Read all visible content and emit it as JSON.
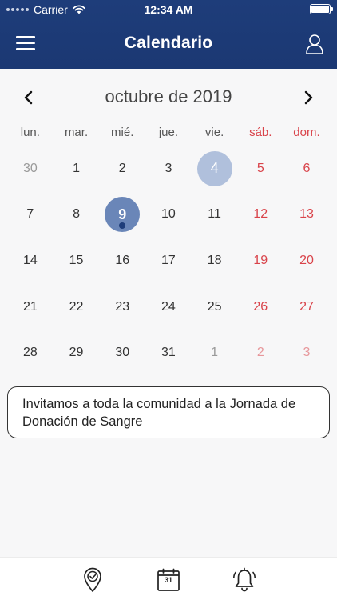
{
  "status_bar": {
    "carrier": "Carrier",
    "time": "12:34 AM"
  },
  "header": {
    "title": "Calendario",
    "menu_icon": "hamburger-menu-icon",
    "user_icon": "user-icon"
  },
  "calendar": {
    "month_label": "octubre de 2019",
    "weekdays": [
      "lun.",
      "mar.",
      "mié.",
      "jue.",
      "vie.",
      "sáb.",
      "dom."
    ],
    "weeks": [
      [
        {
          "d": "30",
          "muted": true
        },
        {
          "d": "1"
        },
        {
          "d": "2"
        },
        {
          "d": "3"
        },
        {
          "d": "4",
          "today": true
        },
        {
          "d": "5"
        },
        {
          "d": "6"
        }
      ],
      [
        {
          "d": "7"
        },
        {
          "d": "8"
        },
        {
          "d": "9",
          "selected": true,
          "has_event": true
        },
        {
          "d": "10"
        },
        {
          "d": "11"
        },
        {
          "d": "12"
        },
        {
          "d": "13"
        }
      ],
      [
        {
          "d": "14"
        },
        {
          "d": "15"
        },
        {
          "d": "16"
        },
        {
          "d": "17"
        },
        {
          "d": "18"
        },
        {
          "d": "19"
        },
        {
          "d": "20"
        }
      ],
      [
        {
          "d": "21"
        },
        {
          "d": "22"
        },
        {
          "d": "23"
        },
        {
          "d": "24"
        },
        {
          "d": "25"
        },
        {
          "d": "26"
        },
        {
          "d": "27"
        }
      ],
      [
        {
          "d": "28"
        },
        {
          "d": "29"
        },
        {
          "d": "30"
        },
        {
          "d": "31"
        },
        {
          "d": "1",
          "muted": true
        },
        {
          "d": "2",
          "muted": true
        },
        {
          "d": "3",
          "muted": true
        }
      ]
    ]
  },
  "event": {
    "text": "Invitamos a toda la comunidad a la Jornada de Donación de Sangre"
  },
  "tabbar": {
    "calendar_day": "31",
    "icons": [
      "location-check-icon",
      "calendar-icon",
      "bell-icon"
    ]
  },
  "colors": {
    "header_bg": "#1e3d7a",
    "weekend": "#d9434a",
    "today_circle": "#b0c0dc",
    "selected_circle": "#6a86b8",
    "event_dot": "#1e3d7a"
  }
}
